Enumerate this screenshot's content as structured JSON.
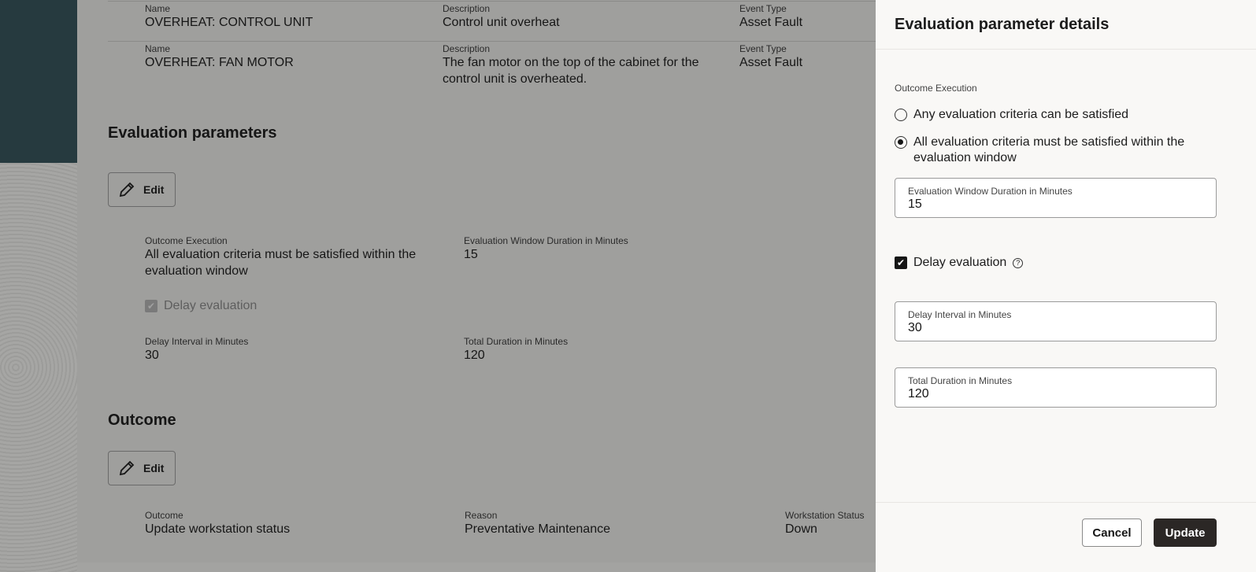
{
  "events": [
    {
      "name_label": "Name",
      "name": "OVERHEAT: CONTROL UNIT",
      "desc_label": "Description",
      "desc": "Control unit overheat",
      "type_label": "Event Type",
      "type": "Asset Fault"
    },
    {
      "name_label": "Name",
      "name": "OVERHEAT: FAN MOTOR",
      "desc_label": "Description",
      "desc": "The fan motor on the top of the cabinet for the control unit is overheated.",
      "type_label": "Event Type",
      "type": "Asset Fault"
    }
  ],
  "eval": {
    "title": "Evaluation parameters",
    "edit": "Edit",
    "outcome_label": "Outcome Execution",
    "outcome": "All evaluation criteria must be satisfied within the evaluation window",
    "window_label": "Evaluation Window Duration in Minutes",
    "window": "15",
    "delay_label": "Delay evaluation",
    "interval_label": "Delay Interval in Minutes",
    "interval": "30",
    "total_label": "Total Duration in Minutes",
    "total": "120"
  },
  "outcome": {
    "title": "Outcome",
    "edit": "Edit",
    "outcome_label": "Outcome",
    "outcome": "Update workstation status",
    "reason_label": "Reason",
    "reason": "Preventative Maintenance",
    "ws_label": "Workstation Status",
    "ws": "Down"
  },
  "panel": {
    "title": "Evaluation parameter details",
    "section": "Outcome Execution",
    "opt_any": "Any evaluation criteria can be satisfied",
    "opt_all": "All evaluation criteria must be satisfied within the evaluation window",
    "selected": "all",
    "window_label": "Evaluation Window Duration in Minutes",
    "window": "15",
    "delay_label": "Delay evaluation",
    "delay_checked": true,
    "interval_label": "Delay Interval in Minutes",
    "interval": "30",
    "total_label": "Total Duration in Minutes",
    "total": "120",
    "cancel": "Cancel",
    "update": "Update"
  }
}
